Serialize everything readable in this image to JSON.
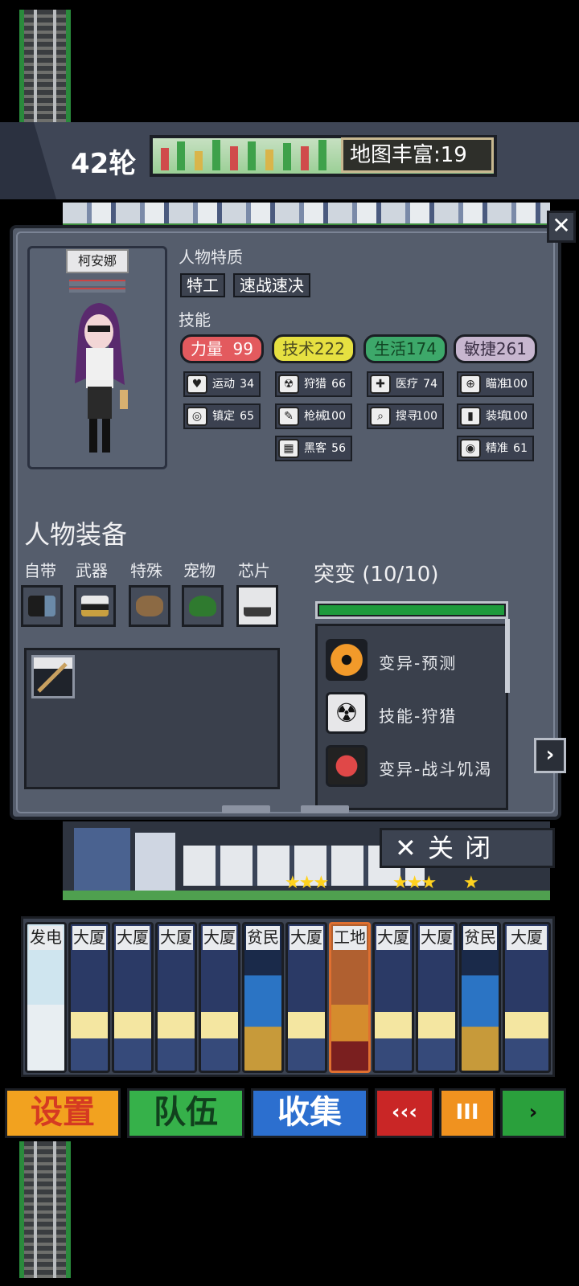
{
  "header": {
    "round": "42轮",
    "map_richness": "地图丰富:19"
  },
  "character": {
    "name": "柯安娜",
    "traits_title": "人物特质",
    "traits": [
      "特工",
      "速战速决"
    ],
    "skills_title": "技能",
    "attributes": [
      {
        "name": "力量",
        "value": "99",
        "color": "#e35a5e"
      },
      {
        "name": "技术",
        "value": "222",
        "color": "#e6e041"
      },
      {
        "name": "生活",
        "value": "174",
        "color": "#3da86a"
      },
      {
        "name": "敏捷",
        "value": "261",
        "color": "#c7b6cf"
      }
    ],
    "skills": {
      "strength": [
        {
          "icon": "heart-icon",
          "glyph": "♥",
          "name": "运动",
          "value": "34"
        },
        {
          "icon": "mask-icon",
          "glyph": "◎",
          "name": "镇定",
          "value": "65"
        }
      ],
      "tech": [
        {
          "icon": "radiation-icon",
          "glyph": "☢",
          "name": "狩猎",
          "value": "66"
        },
        {
          "icon": "wrench-icon",
          "glyph": "✎",
          "name": "枪械",
          "value": "100"
        },
        {
          "icon": "hacker-icon",
          "glyph": "▦",
          "name": "黑客",
          "value": "56"
        }
      ],
      "life": [
        {
          "icon": "medkit-icon",
          "glyph": "✚",
          "name": "医疗",
          "value": "74"
        },
        {
          "icon": "magnifier-icon",
          "glyph": "⌕",
          "name": "搜寻",
          "value": "100"
        }
      ],
      "agility": [
        {
          "icon": "crosshair-icon",
          "glyph": "⊕",
          "name": "瞄准",
          "value": "100"
        },
        {
          "icon": "magazine-icon",
          "glyph": "▮",
          "name": "装填",
          "value": "100"
        },
        {
          "icon": "eye-icon",
          "glyph": "◉",
          "name": "精准",
          "value": "61"
        }
      ]
    }
  },
  "equipment": {
    "title": "人物装备",
    "slots": [
      "自带",
      "武器",
      "特殊",
      "宠物",
      "芯片"
    ]
  },
  "mutation": {
    "title": "突变 (10/10)",
    "progress": 1.0,
    "items": [
      {
        "icon": "cat-eye-icon",
        "label": "变异-预测"
      },
      {
        "icon": "radiation-icon",
        "label": "技能-狩猎"
      },
      {
        "icon": "fist-icon",
        "label": "变异-战斗饥渴"
      }
    ]
  },
  "close_button": "关  闭",
  "cards": [
    "发电",
    "大厦",
    "大厦",
    "大厦",
    "大厦",
    "贫民",
    "大厦",
    "工地",
    "大厦",
    "大厦",
    "贫民",
    "大厦"
  ],
  "bottom_bar": {
    "settings": "设置",
    "team": "队伍",
    "collect": "收集",
    "back": "‹‹‹",
    "pause": "III",
    "next": "›"
  }
}
